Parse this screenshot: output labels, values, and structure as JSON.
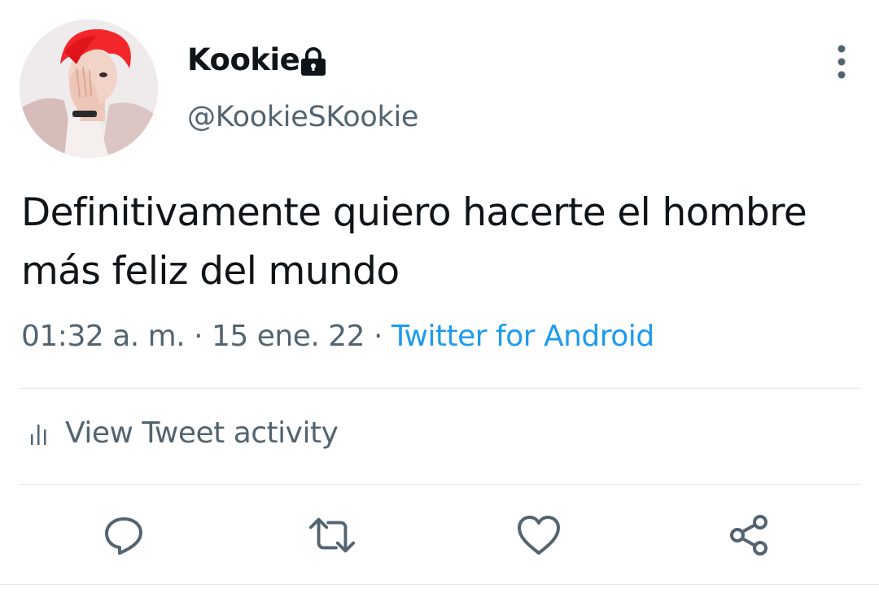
{
  "author": {
    "display_name": "Kookie",
    "handle": "@KookieSKookie",
    "protected_icon": "lock-icon",
    "avatar_colors": {
      "hair": "#f2262b",
      "jacket": "#d8c2c0",
      "skin": "#f1d4c7",
      "background": "#ece7e9"
    }
  },
  "tweet": {
    "text": "Definitivamente quiero hacerte el hombre más feliz del mundo",
    "time": "01:32 a. m.",
    "separator": "·",
    "date": "15 ene. 22",
    "source": "Twitter for Android"
  },
  "activity": {
    "icon": "bar-chart-icon",
    "label": "View Tweet activity"
  },
  "actions": [
    {
      "name": "reply",
      "icon": "reply-icon"
    },
    {
      "name": "retweet",
      "icon": "retweet-icon"
    },
    {
      "name": "like",
      "icon": "heart-icon"
    },
    {
      "name": "share",
      "icon": "share-icon"
    }
  ],
  "menu": {
    "icon": "more-vertical-icon"
  },
  "colors": {
    "text_primary": "#0f1419",
    "text_secondary": "#536471",
    "link": "#1d9bf0",
    "divider": "#e1e6ea"
  }
}
